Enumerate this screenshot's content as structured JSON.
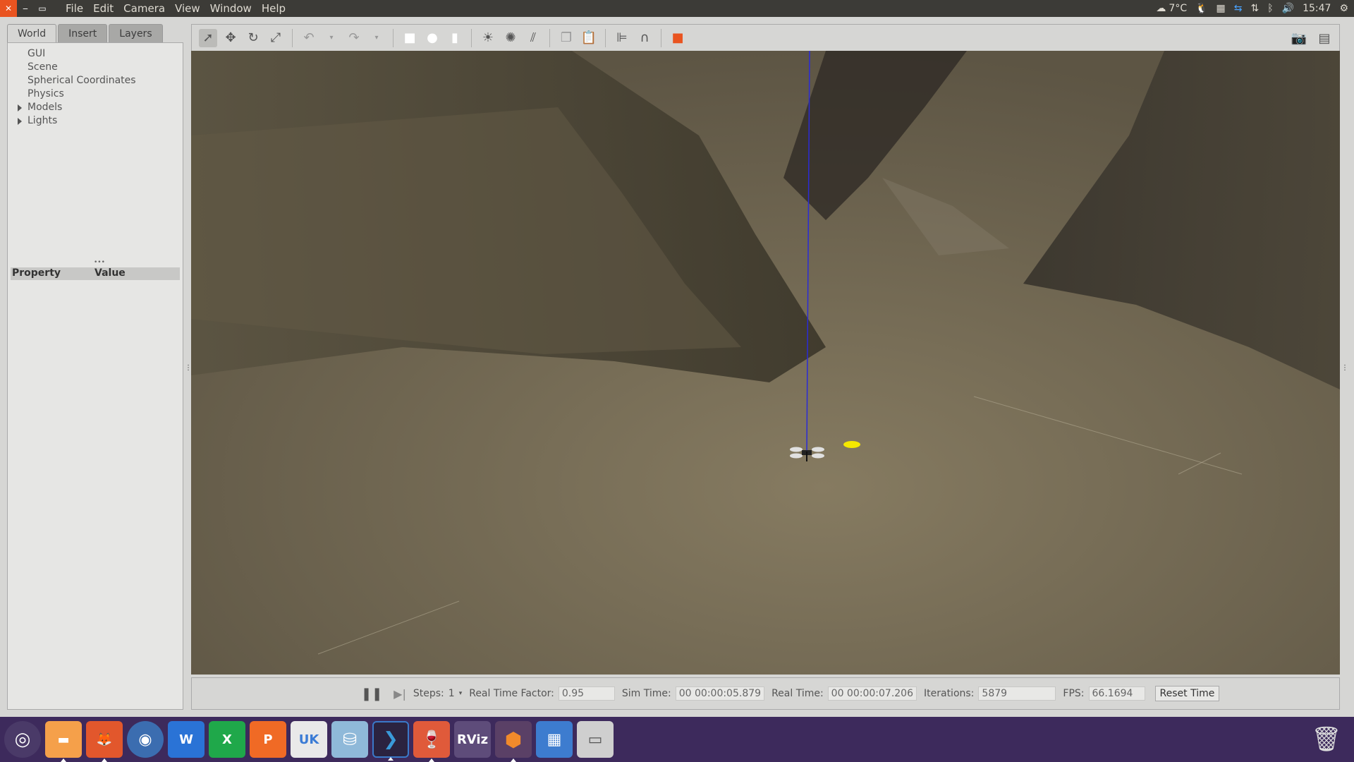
{
  "top_panel": {
    "menu": [
      "File",
      "Edit",
      "Camera",
      "View",
      "Window",
      "Help"
    ],
    "weather": "7°C",
    "clock": "15:47"
  },
  "left_panel": {
    "tabs": [
      "World",
      "Insert",
      "Layers"
    ],
    "tree": [
      "GUI",
      "Scene",
      "Spherical Coordinates",
      "Physics",
      "Models",
      "Lights"
    ],
    "property_header": "Property",
    "value_header": "Value"
  },
  "statusbar": {
    "steps_label": "Steps:",
    "steps_value": "1",
    "rtf_label": "Real Time Factor:",
    "rtf_value": "0.95",
    "sim_time_label": "Sim Time:",
    "sim_time_value": "00 00:00:05.879",
    "real_time_label": "Real Time:",
    "real_time_value": "00 00:00:07.206",
    "iterations_label": "Iterations:",
    "iterations_value": "5879",
    "fps_label": "FPS:",
    "fps_value": "66.1694",
    "reset_label": "Reset Time"
  },
  "launcher": {
    "rviz_label": "RViz",
    "word_label": "W",
    "excel_label": "X",
    "ppt_label": "P",
    "uk_label": "UK"
  },
  "colors": {
    "accent": "#e95420",
    "launcher_bg": "#3d2a5c"
  }
}
